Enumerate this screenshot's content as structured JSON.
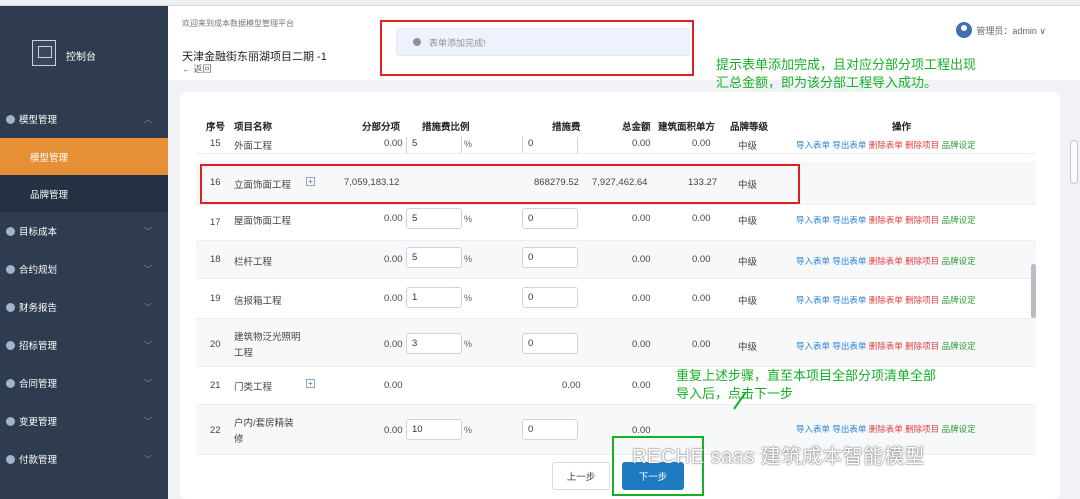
{
  "sidebar": {
    "logo_label": "控制台",
    "menu": [
      {
        "label": "模型管理",
        "expanded": true
      },
      {
        "label": "目标成本"
      },
      {
        "label": "合约规划"
      },
      {
        "label": "财务报告"
      },
      {
        "label": "招标管理"
      },
      {
        "label": "合同管理"
      },
      {
        "label": "变更管理"
      },
      {
        "label": "付款管理"
      }
    ],
    "submenu": [
      {
        "label": "模型管理",
        "active": true
      },
      {
        "label": "品牌管理"
      }
    ]
  },
  "header": {
    "welcome": "欢迎来到成本数据模型管理平台",
    "project_title": "天津金融街东丽湖项目二期 -1",
    "back": "← 返回",
    "admin": "管理员：admin ∨"
  },
  "toast": {
    "message": "表单添加完成!"
  },
  "annotations": {
    "note1_line1": "提示表单添加完成，且对应分部分项工程出现",
    "note1_line2": "汇总金额，即为该分部工程导入成功。",
    "note2_line1": "重复上述步骤，直至本项目全部分项清单全部",
    "note2_line2": "导入后，点击下一步",
    "watermark": "RECHE saas 建筑成本智能模型"
  },
  "table": {
    "headers": {
      "seq": "序号",
      "name": "项目名称",
      "sub": "分部分项",
      "rate": "措施费比例",
      "measure": "措施费",
      "total": "总金额",
      "area_price": "建筑面积单方",
      "grade": "品牌等级",
      "ops": "操作"
    },
    "rows": [
      {
        "seq": "15",
        "name": "外面工程",
        "sub": "0.00",
        "rate": "5",
        "pct": "%",
        "measure": "0",
        "total": "0.00",
        "area": "0.00",
        "grade": "中级"
      },
      {
        "seq": "16",
        "name": "立面饰面工程",
        "sub": "7,059,183.12",
        "measure": "868279.52",
        "total": "7,927,462.64",
        "area": "133.27",
        "grade": "中级"
      },
      {
        "seq": "17",
        "name": "屋面饰面工程",
        "sub": "0.00",
        "rate": "5",
        "pct": "%",
        "measure": "0",
        "total": "0.00",
        "area": "0.00",
        "grade": "中级"
      },
      {
        "seq": "18",
        "name": "栏杆工程",
        "sub": "0.00",
        "rate": "5",
        "pct": "%",
        "measure": "0",
        "total": "0.00",
        "area": "0.00",
        "grade": "中级"
      },
      {
        "seq": "19",
        "name": "信报箱工程",
        "sub": "0.00",
        "rate": "1",
        "pct": "%",
        "measure": "0",
        "total": "0.00",
        "area": "0.00",
        "grade": "中级"
      },
      {
        "seq": "20",
        "name1": "建筑物泛光照明",
        "name2": "工程",
        "sub": "0.00",
        "rate": "3",
        "pct": "%",
        "measure": "0",
        "total": "0.00",
        "area": "0.00",
        "grade": "中级"
      },
      {
        "seq": "21",
        "name": "门类工程",
        "sub": "0.00",
        "measure": "0.00",
        "total": "0.00"
      },
      {
        "seq": "22",
        "name1": "户内/套房精装",
        "name2": "修",
        "sub": "0.00",
        "rate": "10",
        "pct": "%",
        "measure": "0",
        "total": "0.00"
      }
    ],
    "ops": {
      "import": "导入表单",
      "export": "导出表单",
      "delete_form": "删除表单",
      "delete_item": "删除项目",
      "brand": "品牌设定"
    }
  },
  "footer": {
    "prev": "上一步",
    "next": "下一步"
  },
  "colors": {
    "sidebar": "#2f3b4e",
    "active": "#e69036",
    "primary": "#1e7bc2",
    "annotation": "#14b025",
    "highlight_frame": "#e02020"
  }
}
